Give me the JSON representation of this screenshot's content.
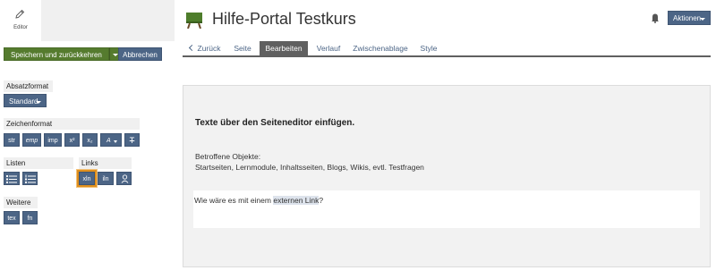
{
  "editor_tab": {
    "label": "Editor",
    "icon": "pencil-icon"
  },
  "toolbar": {
    "save_label": "Speichern und zurückkehren",
    "cancel_label": "Abbrechen"
  },
  "paragraph_format": {
    "heading": "Absatzformat",
    "selected": "Standard"
  },
  "char_format": {
    "heading": "Zeichenformat",
    "buttons": [
      "str",
      "emp",
      "imp",
      "x²",
      "x₂",
      "A",
      "T"
    ]
  },
  "lists": {
    "heading": "Listen"
  },
  "links": {
    "heading": "Links",
    "buttons": [
      "xln",
      "iln"
    ]
  },
  "further": {
    "heading": "Weitere",
    "buttons": [
      "tex",
      "fn"
    ]
  },
  "header": {
    "title": "Hilfe-Portal Testkurs",
    "actions_label": "Aktionen"
  },
  "tabs": [
    {
      "label": "Zurück"
    },
    {
      "label": "Seite"
    },
    {
      "label": "Bearbeiten"
    },
    {
      "label": "Verlauf"
    },
    {
      "label": "Zwischenablage"
    },
    {
      "label": "Style"
    }
  ],
  "content": {
    "heading": "Texte über den Seiteneditor einfügen.",
    "objects_label": "Betroffene Objekte:",
    "objects_list": "Startseiten, Lernmodule, Inhaltsseiten, Blogs, Wikis, evtl. Testfragen",
    "paragraph_before": "Wie wäre es mit einem ",
    "paragraph_link": "externen Link",
    "paragraph_after": "?"
  },
  "colors": {
    "accent_blue": "#4c6586",
    "save_green": "#557b2e",
    "active_highlight": "#e08f1c",
    "active_tab": "#606060"
  }
}
